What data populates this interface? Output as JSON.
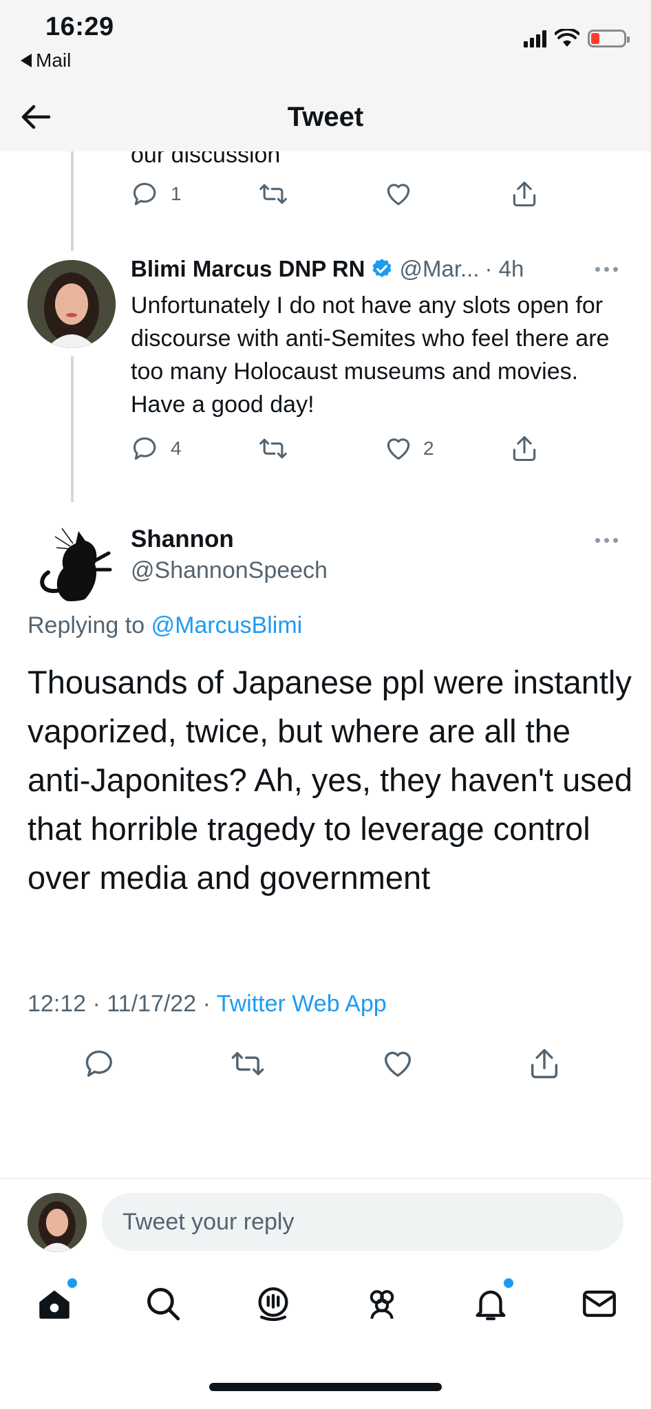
{
  "status_bar": {
    "time": "16:29",
    "back_app": "Mail"
  },
  "header": {
    "title": "Tweet"
  },
  "previous_tweet": {
    "truncated_text": "our discussion",
    "reply_count": "1",
    "retweet_count": "",
    "like_count": ""
  },
  "reply_tweet": {
    "display_name": "Blimi Marcus DNP RN",
    "handle": "@Mar...",
    "time": "· 4h",
    "text": "Unfortunately I do not have any slots open for discourse with anti-Semites who feel there are too many Holocaust museums and movies. Have a good day!",
    "reply_count": "4",
    "retweet_count": "",
    "like_count": "2"
  },
  "main_tweet": {
    "display_name": "Shannon",
    "handle": "@ShannonSpeech",
    "replying_prefix": "Replying to",
    "replying_to": "@MarcusBlimi",
    "text": "Thousands of Japanese ppl were instantly vaporized, twice, but where are all the anti-Japonites? Ah, yes, they haven't used that horrible tragedy to leverage control over media and government",
    "datetime": "12:12 · 11/17/22 ·",
    "source": "Twitter Web App"
  },
  "composer": {
    "placeholder": "Tweet your reply"
  },
  "tabbar": [
    "home-icon",
    "search-icon",
    "spaces-icon",
    "communities-icon",
    "notifications-icon",
    "messages-icon"
  ],
  "colors": {
    "accent": "#1d9bf0",
    "secondary_text": "#536471",
    "line": "#cfd9de"
  }
}
